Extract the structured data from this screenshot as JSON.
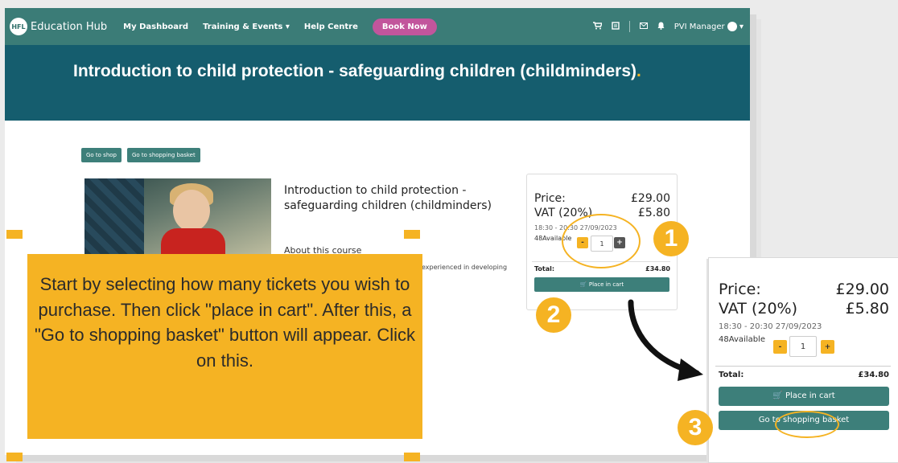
{
  "nav": {
    "logo_text": "HFL",
    "brand": "Education Hub",
    "links": [
      "My Dashboard",
      "Training & Events",
      "Help Centre"
    ],
    "book_now": "Book Now",
    "user": "PVI Manager"
  },
  "hero": {
    "title": "Introduction to child protection - safeguarding children (childminders)",
    "title_dot": "."
  },
  "actions": {
    "go_to_shop": "Go to shop",
    "go_to_basket": "Go to shopping basket"
  },
  "course": {
    "title": "Introduction to child protection - safeguarding children (childminders)",
    "about": "About this course",
    "description_fragment": "experienced in developing"
  },
  "pricing": {
    "price_label": "Price:",
    "price_value": "£29.00",
    "vat_label": "VAT (20%)",
    "vat_value": "£5.80",
    "datetime": "18:30 - 20:30 27/09/2023",
    "available": "48Available",
    "minus": "-",
    "plus": "+",
    "quantity": "1",
    "total_label": "Total:",
    "total_value": "£34.80",
    "place_in_cart": "Place in cart",
    "go_to_basket": "Go to shopping basket"
  },
  "callout": {
    "text": "Start by selecting how many tickets you wish to purchase. Then click \"place in cart\". After this, a \"Go to shopping basket\" button will appear. Click on this."
  },
  "steps": [
    "1",
    "2",
    "3"
  ],
  "colors": {
    "nav_teal": "#3b7c77",
    "hero_blue": "#155d6e",
    "accent_yellow": "#f5b323",
    "button_teal": "#3d7f7a",
    "book_pink": "#c2559c"
  }
}
